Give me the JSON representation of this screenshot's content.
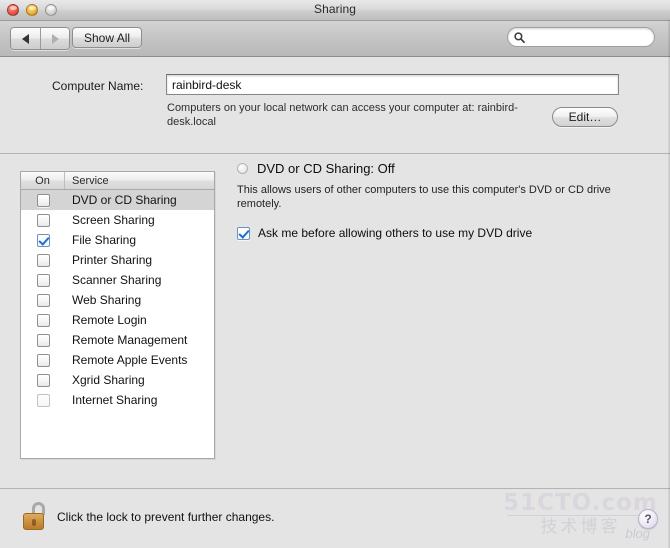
{
  "window": {
    "title": "Sharing",
    "traffic_lights": [
      "close-button",
      "minimize-button",
      "zoom-button"
    ]
  },
  "toolbar": {
    "back_icon": "back-arrow-icon",
    "forward_icon": "forward-arrow-icon",
    "show_all_label": "Show All",
    "search_icon": "search-icon",
    "search_value": "",
    "search_placeholder": ""
  },
  "name_section": {
    "label": "Computer Name:",
    "value": "rainbird-desk",
    "hint": "Computers on your local network can access your computer at: rainbird-desk.local",
    "edit_label": "Edit…"
  },
  "services": {
    "header_on": "On",
    "header_service": "Service",
    "rows": [
      {
        "label": "DVD or CD Sharing",
        "checked": false,
        "selected": true,
        "dimmed": false
      },
      {
        "label": "Screen Sharing",
        "checked": false,
        "selected": false,
        "dimmed": false
      },
      {
        "label": "File Sharing",
        "checked": true,
        "selected": false,
        "dimmed": false
      },
      {
        "label": "Printer Sharing",
        "checked": false,
        "selected": false,
        "dimmed": false
      },
      {
        "label": "Scanner Sharing",
        "checked": false,
        "selected": false,
        "dimmed": false
      },
      {
        "label": "Web Sharing",
        "checked": false,
        "selected": false,
        "dimmed": false
      },
      {
        "label": "Remote Login",
        "checked": false,
        "selected": false,
        "dimmed": false
      },
      {
        "label": "Remote Management",
        "checked": false,
        "selected": false,
        "dimmed": false
      },
      {
        "label": "Remote Apple Events",
        "checked": false,
        "selected": false,
        "dimmed": false
      },
      {
        "label": "Xgrid Sharing",
        "checked": false,
        "selected": false,
        "dimmed": false
      },
      {
        "label": "Internet Sharing",
        "checked": false,
        "selected": false,
        "dimmed": true
      }
    ]
  },
  "detail": {
    "status_indicator": "status-off-indicator",
    "status_text": "DVD or CD Sharing: Off",
    "description": "This allows users of other computers to use this computer's DVD or CD drive remotely.",
    "ask_checkbox_checked": true,
    "ask_label": "Ask me before allowing others to use my DVD drive"
  },
  "bottom": {
    "lock_icon": "unlocked-padlock-icon",
    "lock_text": "Click the lock to prevent further changes.",
    "help_label": "?"
  },
  "watermark": {
    "line1": "51CTO.com",
    "line2": "技术博客",
    "blog": "blog"
  },
  "colors": {
    "accent_checkbox": "#1f6fd0",
    "window_bg": "#e4e4e4",
    "selected_row": "#d4d4d4",
    "lock_gold": "#d19644"
  }
}
